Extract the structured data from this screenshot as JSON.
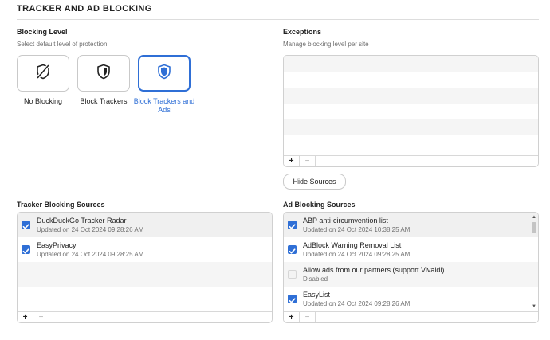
{
  "section": {
    "title": "TRACKER AND AD BLOCKING"
  },
  "blocking_level": {
    "heading": "Blocking Level",
    "subtitle": "Select default level of protection.",
    "options": [
      {
        "label": "No Blocking",
        "icon": "shield-off-icon",
        "selected": false
      },
      {
        "label": "Block Trackers",
        "icon": "shield-half-icon",
        "selected": false
      },
      {
        "label": "Block Trackers and Ads",
        "icon": "shield-full-icon",
        "selected": true
      }
    ]
  },
  "exceptions": {
    "heading": "Exceptions",
    "subtitle": "Manage blocking level per site",
    "add_label": "+",
    "remove_label": "−",
    "hide_sources_label": "Hide Sources"
  },
  "tracker_sources": {
    "heading": "Tracker Blocking Sources",
    "items": [
      {
        "name": "DuckDuckGo Tracker Radar",
        "date": "Updated on 24 Oct 2024 09:28:26 AM",
        "checked": true
      },
      {
        "name": "EasyPrivacy",
        "date": "Updated on 24 Oct 2024 09:28:25 AM",
        "checked": true
      }
    ],
    "add_label": "+",
    "remove_label": "−"
  },
  "ad_sources": {
    "heading": "Ad Blocking Sources",
    "items": [
      {
        "name": "ABP anti-circumvention list",
        "date": "Updated on 24 Oct 2024 10:38:25 AM",
        "checked": true
      },
      {
        "name": "AdBlock Warning Removal List",
        "date": "Updated on 24 Oct 2024 09:28:25 AM",
        "checked": true
      },
      {
        "name": "Allow ads from our partners (support Vivaldi)",
        "date": "Disabled",
        "checked": false
      },
      {
        "name": "EasyList",
        "date": "Updated on 24 Oct 2024 09:28:26 AM",
        "checked": true
      }
    ],
    "add_label": "+",
    "remove_label": "−"
  },
  "colors": {
    "accent": "#2f6fd6",
    "border": "#c9c9c9",
    "muted_text": "#6e6e6e"
  }
}
